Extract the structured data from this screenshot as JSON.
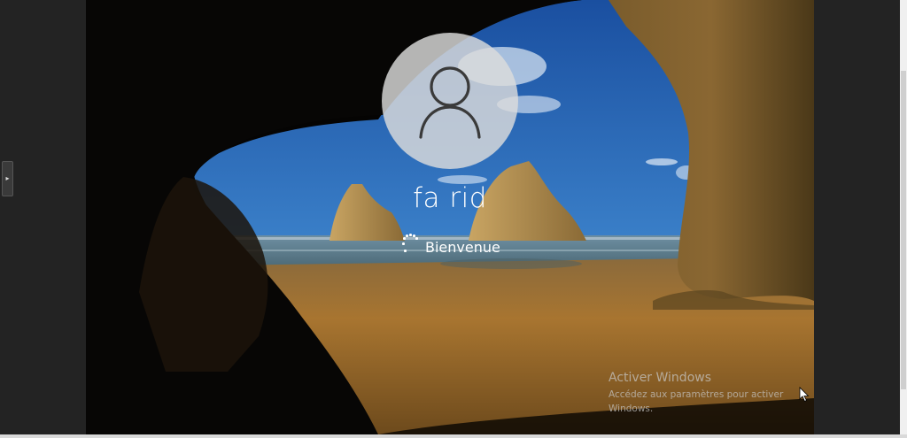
{
  "login": {
    "user_name": "fa rid",
    "status_text": "Bienvenue"
  },
  "watermark": {
    "title": "Activer Windows",
    "line1": "Accédez aux paramètres pour activer",
    "line2": "Windows."
  },
  "icons": {
    "avatar": "user-silhouette-icon",
    "spinner": "loading-spinner-icon",
    "cursor": "mouse-pointer-icon",
    "side_handle": "chevron-right-icon"
  },
  "colors": {
    "sky": "#2a6bb8",
    "sand": "#a36f2c",
    "sea": "#5f8296",
    "rock": "#6e5426",
    "avatar_disc": "#dcdcdc",
    "text": "#ffffff"
  }
}
